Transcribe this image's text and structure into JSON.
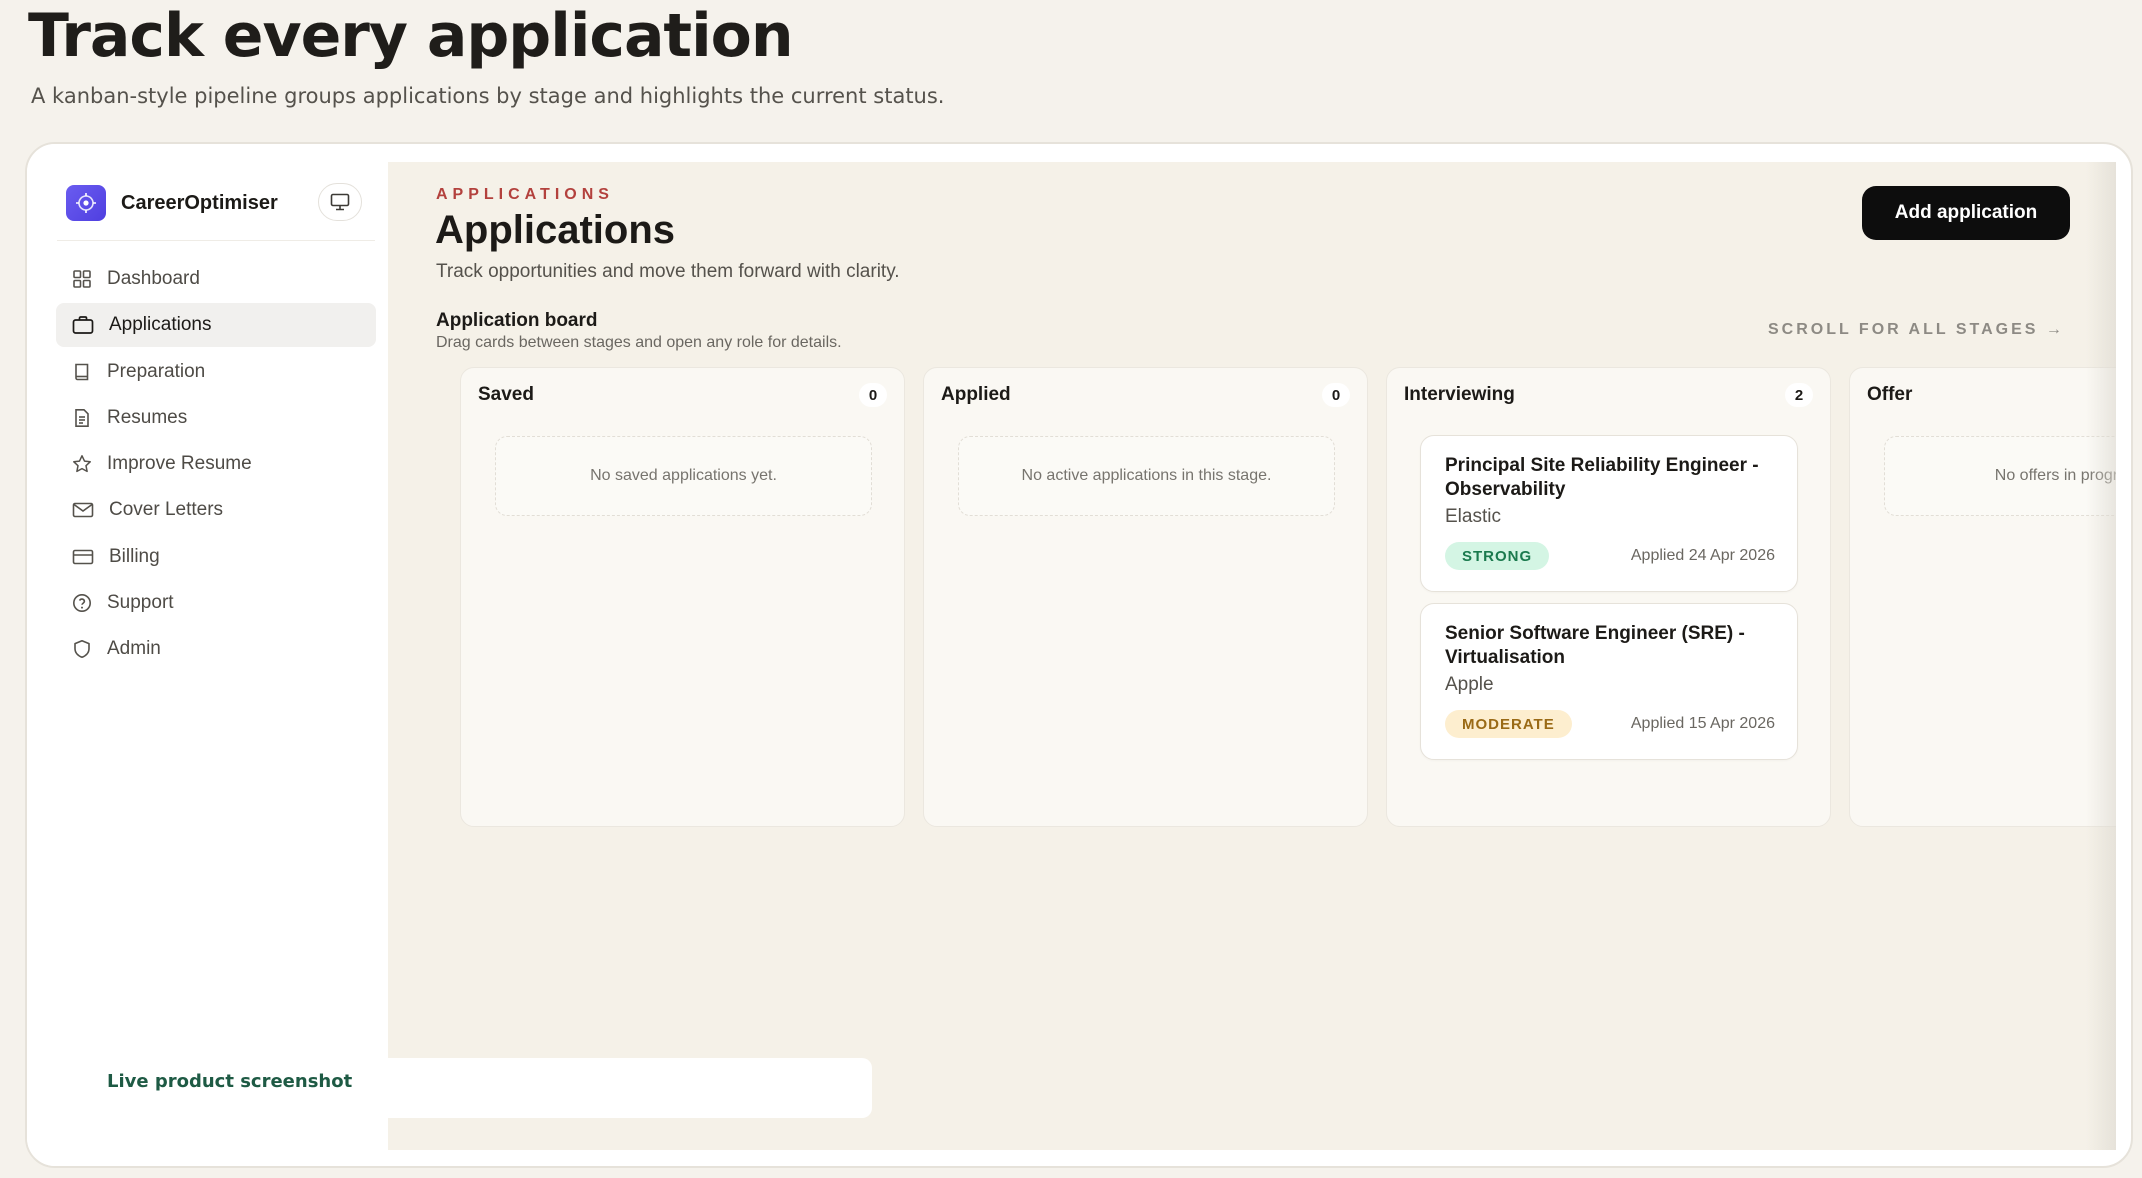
{
  "hero": {
    "title": "Track every application",
    "subtitle": "A kanban-style pipeline groups applications by stage and highlights the current status."
  },
  "sidebar": {
    "brand": "CareerOptimiser",
    "items": [
      {
        "label": "Dashboard",
        "icon": "grid-icon",
        "active": false
      },
      {
        "label": "Applications",
        "icon": "briefcase-icon",
        "active": true
      },
      {
        "label": "Preparation",
        "icon": "book-icon",
        "active": false
      },
      {
        "label": "Resumes",
        "icon": "document-icon",
        "active": false
      },
      {
        "label": "Improve Resume",
        "icon": "star-icon",
        "active": false
      },
      {
        "label": "Cover Letters",
        "icon": "mail-icon",
        "active": false
      },
      {
        "label": "Billing",
        "icon": "credit-card-icon",
        "active": false
      },
      {
        "label": "Support",
        "icon": "help-circle-icon",
        "active": false
      },
      {
        "label": "Admin",
        "icon": "shield-icon",
        "active": false
      }
    ],
    "live_label": "Live product screenshot"
  },
  "main": {
    "eyebrow": "APPLICATIONS",
    "title": "Applications",
    "subtitle": "Track opportunities and move them forward with clarity.",
    "add_button": "Add application",
    "board_title": "Application board",
    "board_subtitle": "Drag cards between stages and open any role for details.",
    "scroll_hint": "SCROLL FOR ALL STAGES →",
    "columns": [
      {
        "title": "Saved",
        "count": "0",
        "empty": "No saved applications yet."
      },
      {
        "title": "Applied",
        "count": "0",
        "empty": "No active applications in this stage."
      },
      {
        "title": "Interviewing",
        "count": "2",
        "cards": [
          {
            "title": "Principal Site Reliability Engineer - Observability",
            "company": "Elastic",
            "badge": "STRONG",
            "date": "Applied 24 Apr 2026"
          },
          {
            "title": "Senior Software Engineer (SRE) - Virtualisation",
            "company": "Apple",
            "badge": "MODERATE",
            "date": "Applied 15 Apr 2026"
          }
        ]
      },
      {
        "title": "Offer",
        "empty": "No offers in progress"
      }
    ]
  },
  "colors": {
    "accent": "#5b4de8",
    "eyebrow": "#b3413d",
    "strong_badge": "#d4f5e4",
    "moderate_badge": "#fdeecf",
    "live_label": "#1e5a44"
  }
}
